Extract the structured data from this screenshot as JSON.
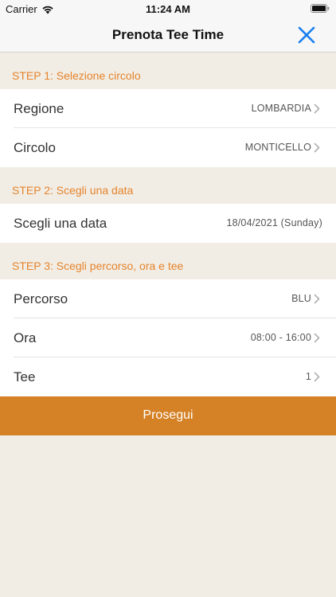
{
  "status_bar": {
    "carrier": "Carrier",
    "time": "11:24 AM"
  },
  "nav": {
    "title": "Prenota Tee Time",
    "close_icon": "close-x-icon"
  },
  "colors": {
    "accent_orange": "#e6832a",
    "button_orange": "#d58125",
    "close_blue": "#1a7ef0",
    "background": "#f1ede5"
  },
  "steps": [
    {
      "header": "STEP 1: Selezione circolo",
      "rows": [
        {
          "label": "Regione",
          "value": "LOMBARDIA"
        },
        {
          "label": "Circolo",
          "value": "MONTICELLO"
        }
      ]
    },
    {
      "header": "STEP 2: Scegli una data",
      "rows": [
        {
          "label": "Scegli una data",
          "value": "18/04/2021 (Sunday)"
        }
      ]
    },
    {
      "header": "STEP 3: Scegli percorso, ora e tee",
      "rows": [
        {
          "label": "Percorso",
          "value": "BLU"
        },
        {
          "label": "Ora",
          "value": "08:00 - 16:00"
        },
        {
          "label": "Tee",
          "value": "1"
        }
      ]
    }
  ],
  "continue_button": {
    "label": "Prosegui"
  }
}
